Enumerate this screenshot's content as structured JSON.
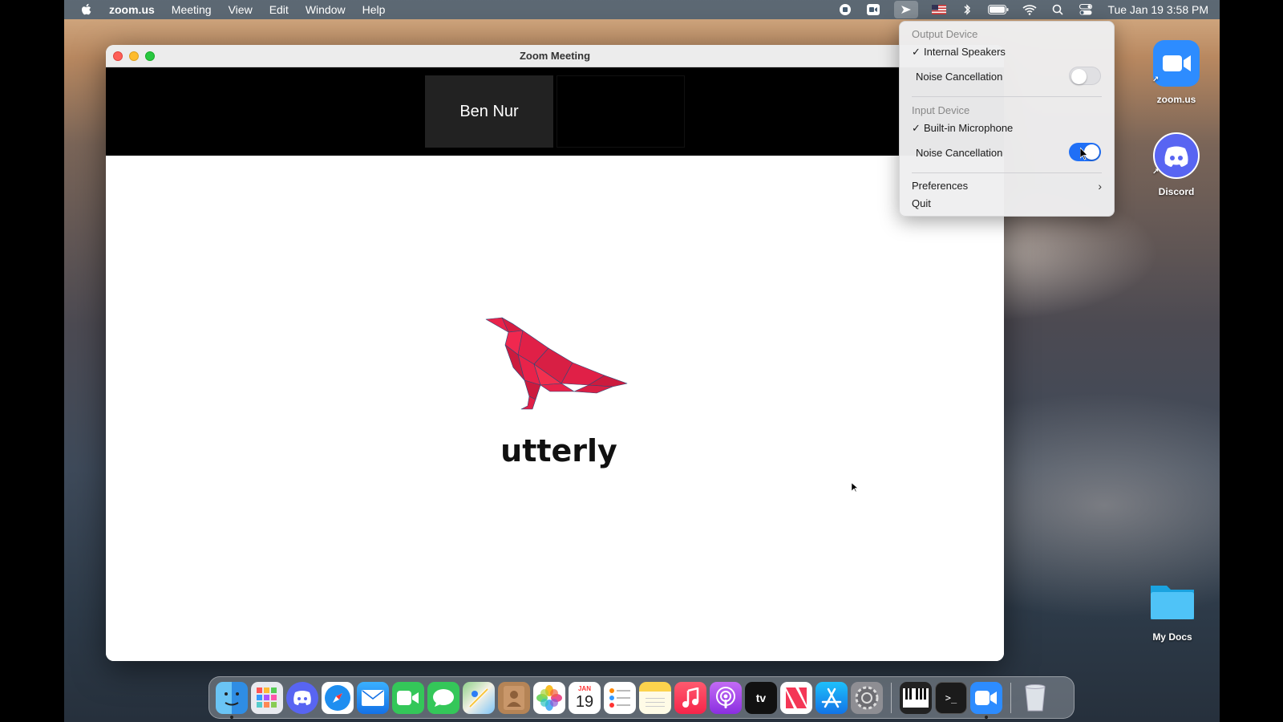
{
  "menubar": {
    "app_name": "zoom.us",
    "menus": [
      "Meeting",
      "View",
      "Edit",
      "Window",
      "Help"
    ],
    "clock": "Tue Jan 19  3:58 PM"
  },
  "window": {
    "title": "Zoom Meeting",
    "participant_name": "Ben Nur"
  },
  "shared_content": {
    "logo_text": "utterly",
    "logo_color": "#e8234a"
  },
  "audio_menu": {
    "output_header": "Output Device",
    "output_device": "Internal Speakers",
    "output_noise_label": "Noise Cancellation",
    "output_noise_on": false,
    "input_header": "Input Device",
    "input_device": "Built-in Microphone",
    "input_noise_label": "Noise Cancellation",
    "input_noise_on": true,
    "preferences": "Preferences",
    "quit": "Quit"
  },
  "desktop_icons": {
    "zoom": "zoom.us",
    "discord": "Discord",
    "docs": "My Docs"
  },
  "dock": {
    "apps": [
      "Finder",
      "Launchpad",
      "Discord",
      "Safari",
      "Mail",
      "FaceTime",
      "Messages",
      "Maps",
      "Contacts",
      "Photos",
      "Calendar",
      "Reminders",
      "Notes",
      "Music",
      "Podcasts",
      "TV",
      "News",
      "App Store",
      "System Preferences",
      "Piano",
      "Terminal",
      "Zoom",
      "Trash"
    ],
    "calendar_month": "JAN",
    "calendar_day": "19"
  },
  "colors": {
    "toggle_on": "#1f6ff6",
    "zoom_blue": "#2d8cff",
    "discord_blurple": "#5865f2"
  }
}
